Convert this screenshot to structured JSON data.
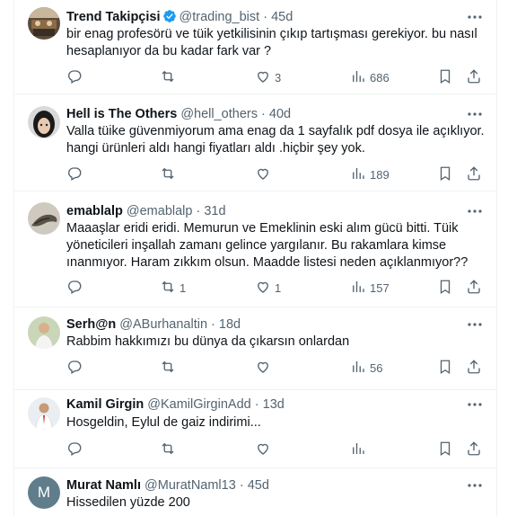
{
  "tweets": [
    {
      "name": "Trend Takipçisi",
      "verified": true,
      "handle": "@trading_bist",
      "time": "45d",
      "text": "bir enag profesörü ve tüik yetkilisinin çıkıp tartışması gerekiyor. bu nasıl hesaplanıyor da bu kadar fark var ?",
      "replies": "",
      "retweets": "",
      "likes": "3",
      "views": "686",
      "avatar": "avatar-trend"
    },
    {
      "name": "Hell is The Others",
      "verified": false,
      "handle": "@hell_others",
      "time": "40d",
      "text": "Valla tüike güvenmiyorum ama enag da 1 sayfalık pdf dosya ile açıklıyor. hangi ürünleri aldı hangi fiyatları aldı .hiçbir şey yok.",
      "replies": "",
      "retweets": "",
      "likes": "",
      "views": "189",
      "avatar": "avatar-hell"
    },
    {
      "name": "emablalp",
      "verified": false,
      "handle": "@emablalp",
      "time": "31d",
      "text": "Maaaşlar eridi eridi. Memurun ve Emeklinin eski alım gücü bitti. Tüik yöneticileri inşallah zamanı gelince yargılanır. Bu rakamlara kimse ınanmıyor. Haram zıkkım olsun. Maadde listesi neden açıklanmıyor??",
      "replies": "",
      "retweets": "1",
      "likes": "1",
      "views": "157",
      "avatar": "avatar-emab"
    },
    {
      "name": "Serh@n",
      "verified": false,
      "handle": "@ABurhanaltin",
      "time": "18d",
      "text": "Rabbim hakkımızı bu dünya da çıkarsın onlardan",
      "replies": "",
      "retweets": "",
      "likes": "",
      "views": "56",
      "avatar": "avatar-serhan"
    },
    {
      "name": "Kamil Girgin",
      "verified": false,
      "handle": "@KamilGirginAdd",
      "time": "13d",
      "text": "Hosgeldin, Eylul de gaiz indirimi...",
      "replies": "",
      "retweets": "",
      "likes": "",
      "views": "",
      "avatar": "avatar-kamil"
    },
    {
      "name": "Murat Namlı",
      "verified": false,
      "handle": "@MuratNaml13",
      "time": "45d",
      "text": "Hissedilen yüzde 200",
      "replies": "",
      "retweets": "",
      "likes": "",
      "views": "",
      "avatar": "avatar-murat",
      "avatar_letter": "M"
    }
  ],
  "dot": "·",
  "colors": {
    "text": "#0f1419",
    "muted": "#536471",
    "verified": "#1d9bf0",
    "divider": "#eff3f4",
    "murat_avatar": "#607d8b"
  }
}
